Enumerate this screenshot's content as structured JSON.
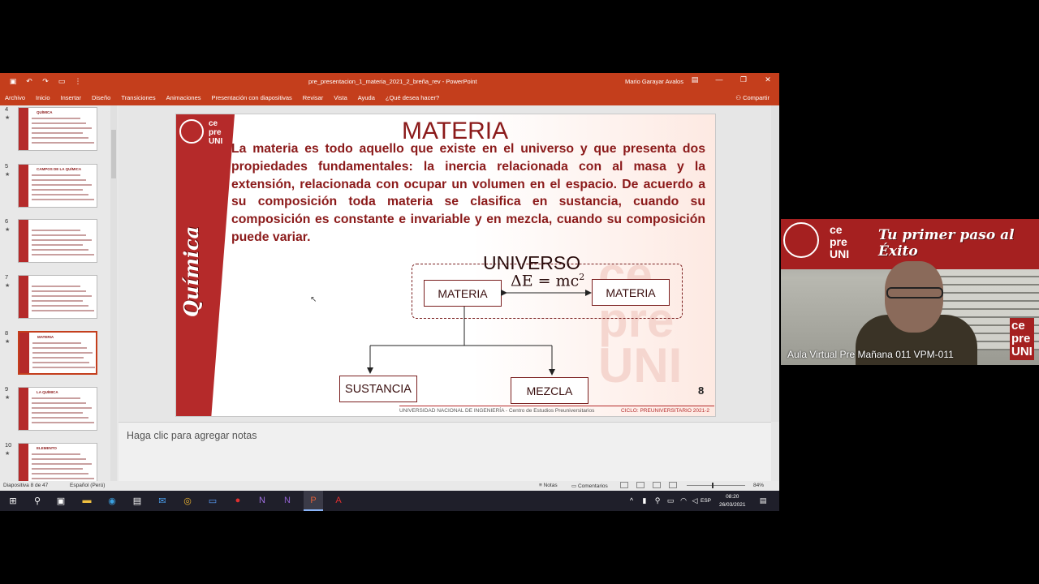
{
  "window": {
    "title": "pre_presentacion_1_materia_2021_2_breña_rev  -  PowerPoint",
    "user": "Mario Garayar Avalos"
  },
  "ribbon": {
    "tabs": [
      "Archivo",
      "Inicio",
      "Insertar",
      "Diseño",
      "Transiciones",
      "Animaciones",
      "Presentación con diapositivas",
      "Revisar",
      "Vista",
      "Ayuda",
      "¿Qué desea hacer?"
    ],
    "share": "Compartir"
  },
  "thumbnails": [
    {
      "num": "4",
      "title": "QUÍMICA"
    },
    {
      "num": "5",
      "title": "CAMPOS DE LA QUÍMICA"
    },
    {
      "num": "6",
      "title": ""
    },
    {
      "num": "7",
      "title": ""
    },
    {
      "num": "8",
      "title": "MATERIA"
    },
    {
      "num": "9",
      "title": "LA QUÍMICA"
    },
    {
      "num": "10",
      "title": "ELEMENTO"
    }
  ],
  "slide": {
    "logo_text": "ce\npre\nUNI",
    "side_text": "Química",
    "title": "MATERIA",
    "body": "La materia es todo aquello que existe en el universo y que presenta dos propiedades fundamentales: la inercia relacionada con al masa y la extensión, relacionada con  ocupar un volumen en el espacio. De acuerdo a su composición toda materia se clasifica en sustancia, cuando su composición es constante e invariable y en mezcla, cuando su composición puede variar.",
    "universo": "UNIVERSO",
    "materia_left": "MATERIA",
    "materia_right": "MATERIA",
    "equation": "ΔE = mc",
    "equation_exp": "2",
    "sustancia": "SUSTANCIA",
    "mezcla": "MEZCLA",
    "page_number": "8",
    "footer_left": "UNIVERSIDAD NACIONAL DE INGENIERÍA - Centro de Estudios Preuniversitarios",
    "footer_right": "CICLO: PREUNIVERSITARIO 2021-2"
  },
  "notes_placeholder": "Haga clic para agregar notas",
  "status": {
    "slide_of": "Diapositiva 8 de 47",
    "language": "Español (Perú)",
    "notes": "Notas",
    "comments": "Comentarios",
    "zoom": "84%"
  },
  "taskbar": {
    "time": "08:20",
    "date": "26/03/2021",
    "lang": "ESP"
  },
  "webcam": {
    "banner": "ce\npre\nUNI",
    "slogan": "Tu primer paso al Éxito",
    "right_logo": "ce\npre\nUNI",
    "caption": "Aula Virtual Pre Mañana 011 VPM-011"
  },
  "colors": {
    "ppt_accent": "#c43e1c",
    "slide_red": "#b52a2a",
    "text_maroon": "#8b1a1a"
  }
}
